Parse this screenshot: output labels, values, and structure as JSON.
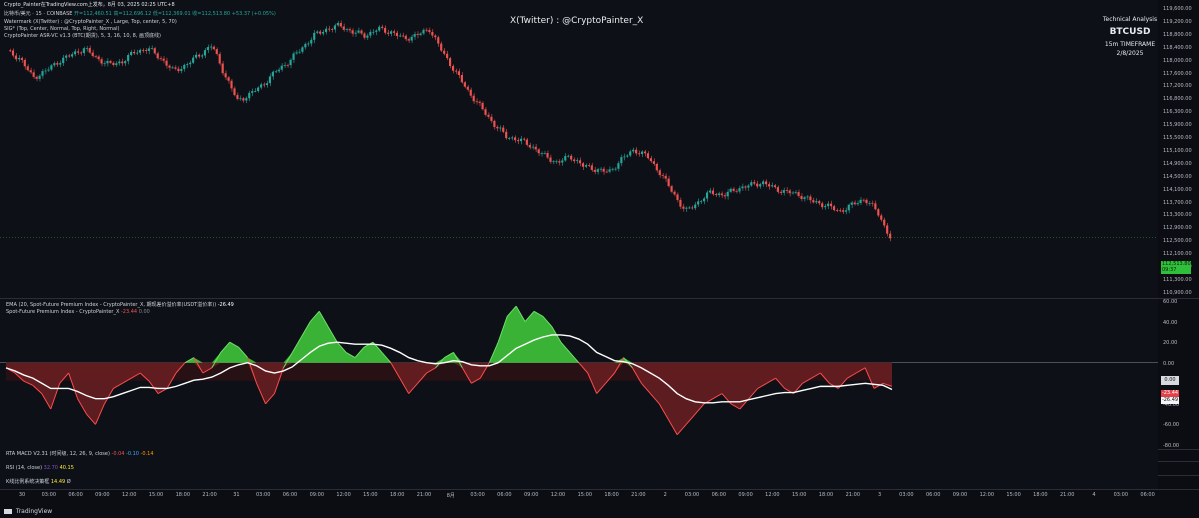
{
  "header": {
    "title_line": "Crypto_Painter在TradingView.com上发布，8月 03, 2025 02:25 UTC+8",
    "symbol_line": "比特币/美元 · 15 · COINBASE",
    "ohlc": {
      "o": "开=112,460.51",
      "h": "高=112,696.12",
      "l": "低=112,369.01",
      "c": "收=112,513.80",
      "chg": "+53.37 (+0.05%)"
    },
    "watermark_ind": "Watermark (X(Twitter) : @CryptoPainter_X , Large, Top, center, 5, 70)",
    "sig_ind": "SIG* (Top, Center, Normal, Top, Right, Normal)",
    "asr_ind": "CryptoPainter ASR-VC v1.3 (BTC(期货), 5, 3, 16, 10, 8, 画顶底线)"
  },
  "watermark": "X(Twitter) : @CryptoPainter_X",
  "tech": {
    "title": "Technical Analysis",
    "symbol": "BTCUSD",
    "timeframe": "15m TIMEFRAME",
    "date": "2/8/2025"
  },
  "price_axis": [
    "119,600.00",
    "119,200.00",
    "118,800.00",
    "118,400.00",
    "118,000.00",
    "117,600.00",
    "117,200.00",
    "116,800.00",
    "116,300.00",
    "115,900.00",
    "115,500.00",
    "115,100.00",
    "114,900.00",
    "114,500.00",
    "114,100.00",
    "113,700.00",
    "113,300.00",
    "112,900.00",
    "112,500.00",
    "112,100.00",
    "111,700.00",
    "111,300.00",
    "110,900.00"
  ],
  "price_tag": {
    "line1": "112,513.80",
    "line2": "09:37"
  },
  "indicator": {
    "ema_label": "EMA (20, Spot-Future Premium Index - CryptoPainter_X, 期现差价溢价率(USDT溢价率))",
    "ema_value": "-26.49",
    "spi_label": "Spot-Future Premium Index - CryptoPainter_X",
    "spi_value1": "-23.44",
    "spi_value2": "0.00",
    "axis": [
      "60.00",
      "40.00",
      "20.00",
      "0.00",
      "-20.00",
      "-40.00",
      "-60.00",
      "-80.00"
    ],
    "zero_tag": "0.00",
    "red_tag": "-23.44",
    "white_tag": "-26.49",
    "chart_data": {
      "type": "area",
      "ylim": [
        -80,
        60
      ],
      "series": [
        {
          "values": [
            -5,
            -10,
            -18,
            -22,
            -30,
            -45,
            -20,
            -10,
            -35,
            -50,
            -60,
            -40,
            -25,
            -20,
            -15,
            -10,
            -18,
            -30,
            -25,
            -10,
            0,
            5,
            -10,
            -5,
            10,
            20,
            15,
            5,
            -20,
            -40,
            -30,
            -5,
            10,
            25,
            40,
            50,
            35,
            20,
            10,
            5,
            15,
            20,
            10,
            0,
            -15,
            -30,
            -20,
            -10,
            -5,
            5,
            10,
            -5,
            -20,
            -15,
            0,
            20,
            45,
            55,
            40,
            50,
            45,
            35,
            20,
            10,
            0,
            -10,
            -30,
            -20,
            -10,
            5,
            -5,
            -20,
            -30,
            -40,
            -55,
            -70,
            -60,
            -50,
            -40,
            -35,
            -30,
            -40,
            -45,
            -35,
            -25,
            -20,
            -15,
            -25,
            -30,
            -20,
            -15,
            -10,
            -20,
            -25,
            -15,
            -10,
            -5,
            -25,
            -20,
            -23
          ]
        },
        {
          "values": [
            -5,
            -8,
            -12,
            -15,
            -20,
            -25,
            -25,
            -25,
            -28,
            -32,
            -35,
            -35,
            -33,
            -30,
            -27,
            -24,
            -24,
            -25,
            -25,
            -23,
            -20,
            -17,
            -16,
            -14,
            -10,
            -5,
            -2,
            0,
            -3,
            -8,
            -10,
            -8,
            -4,
            3,
            10,
            16,
            19,
            20,
            19,
            18,
            18,
            18,
            17,
            14,
            10,
            5,
            2,
            0,
            -1,
            0,
            2,
            1,
            -2,
            -3,
            -3,
            0,
            7,
            14,
            18,
            22,
            25,
            27,
            27,
            26,
            23,
            18,
            10,
            6,
            2,
            1,
            -1,
            -5,
            -10,
            -15,
            -22,
            -30,
            -35,
            -38,
            -39,
            -39,
            -38,
            -38,
            -38,
            -36,
            -34,
            -32,
            -30,
            -29,
            -29,
            -27,
            -25,
            -23,
            -23,
            -23,
            -22,
            -21,
            -20,
            -21,
            -22,
            -26
          ]
        }
      ]
    }
  },
  "macd": {
    "label": "RTA MACD V2.31 (时间级, 12, 26, 9, close)",
    "v1": "-0.04",
    "v2": "-0.10",
    "v3": "-0.14"
  },
  "rsi": {
    "label": "RSI (14, close)",
    "v1": "32.70",
    "v2": "40.15"
  },
  "kline": {
    "label": "K线比例系统决策框",
    "v1": "14.49",
    "v2": "Ø"
  },
  "time_axis": [
    "30",
    "03:00",
    "06:00",
    "09:00",
    "12:00",
    "15:00",
    "18:00",
    "21:00",
    "31",
    "03:00",
    "06:00",
    "09:00",
    "12:00",
    "15:00",
    "18:00",
    "21:00",
    "8月",
    "03:00",
    "06:00",
    "09:00",
    "12:00",
    "15:00",
    "18:00",
    "21:00",
    "2",
    "03:00",
    "06:00",
    "09:00",
    "12:00",
    "15:00",
    "18:00",
    "21:00",
    "3",
    "03:00",
    "06:00",
    "09:00",
    "12:00",
    "15:00",
    "18:00",
    "21:00",
    "4",
    "03:00",
    "06:00"
  ],
  "footer": {
    "logo": "TradingView"
  },
  "colors": {
    "up": "#26a69a",
    "down": "#ef5350",
    "green_fill": "#3ec43a",
    "red_fill": "#6b1e22"
  },
  "chart_data": {
    "type": "line",
    "title": "BTCUSD",
    "ylim": [
      110900,
      119600
    ],
    "x": [
      "30",
      "31",
      "8月",
      "2",
      "3"
    ],
    "series": [
      {
        "name": "BTCUSD",
        "values": [
          118200,
          118000,
          117400,
          117600,
          117900,
          118100,
          118300,
          118000,
          117800,
          117900,
          118200,
          118300,
          118000,
          117600,
          117800,
          118100,
          118400,
          117500,
          116700,
          116900,
          117200,
          117600,
          117900,
          118300,
          118700,
          118900,
          119000,
          118800,
          118700,
          118900,
          118800,
          118600,
          118700,
          118900,
          118200,
          117600,
          117000,
          116500,
          116000,
          115600,
          115500,
          115300,
          115000,
          114800,
          115000,
          114700,
          114600,
          114500,
          114900,
          115200,
          115000,
          114500,
          113900,
          113300,
          113600,
          113900,
          113800,
          114000,
          114100,
          114200,
          114000,
          113900,
          113800,
          113600,
          113500,
          113300,
          113500,
          113700,
          113300,
          112500
        ]
      }
    ]
  }
}
